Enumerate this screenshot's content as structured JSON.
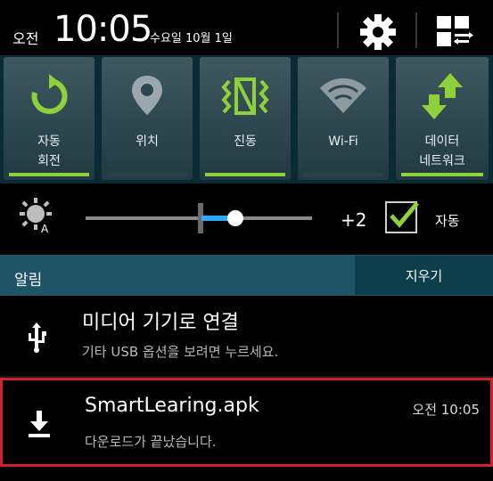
{
  "status_bar": {
    "ampm": "오전",
    "time": "10:05",
    "date": "수요일 10월 1일",
    "icons": [
      "gear-icon",
      "grid-edit-icon"
    ]
  },
  "quick_toggles": [
    {
      "label": "자동\n회전",
      "icon": "rotate-icon",
      "enabled": true
    },
    {
      "label": "위치",
      "icon": "location-icon",
      "enabled": false
    },
    {
      "label": "진동",
      "icon": "vibrate-icon",
      "enabled": true
    },
    {
      "label": "Wi-Fi",
      "icon": "wifi-icon",
      "enabled": false
    },
    {
      "label": "데이터\n네트워크",
      "icon": "data-network-icon",
      "enabled": true
    }
  ],
  "brightness": {
    "value": "+2",
    "level": 0.66,
    "auto_label": "자동",
    "auto_checked": true
  },
  "notifications": {
    "title": "알림",
    "clear_label": "지우기",
    "items": [
      {
        "title": "미디어 기기로 연결",
        "subtitle": "기타 USB 옵션을 보려면 누르세요.",
        "time": "",
        "icon": "usb-icon"
      },
      {
        "title": "SmartLearing.apk",
        "subtitle": "다운로드가 끝났습니다.",
        "time": "오전 10:05",
        "icon": "download-icon"
      }
    ]
  },
  "colors": {
    "accent_green": "#8fd13a",
    "highlight_red": "#d1202a",
    "slider_blue": "#2ea8ff",
    "header_teal": "#1d5466"
  }
}
